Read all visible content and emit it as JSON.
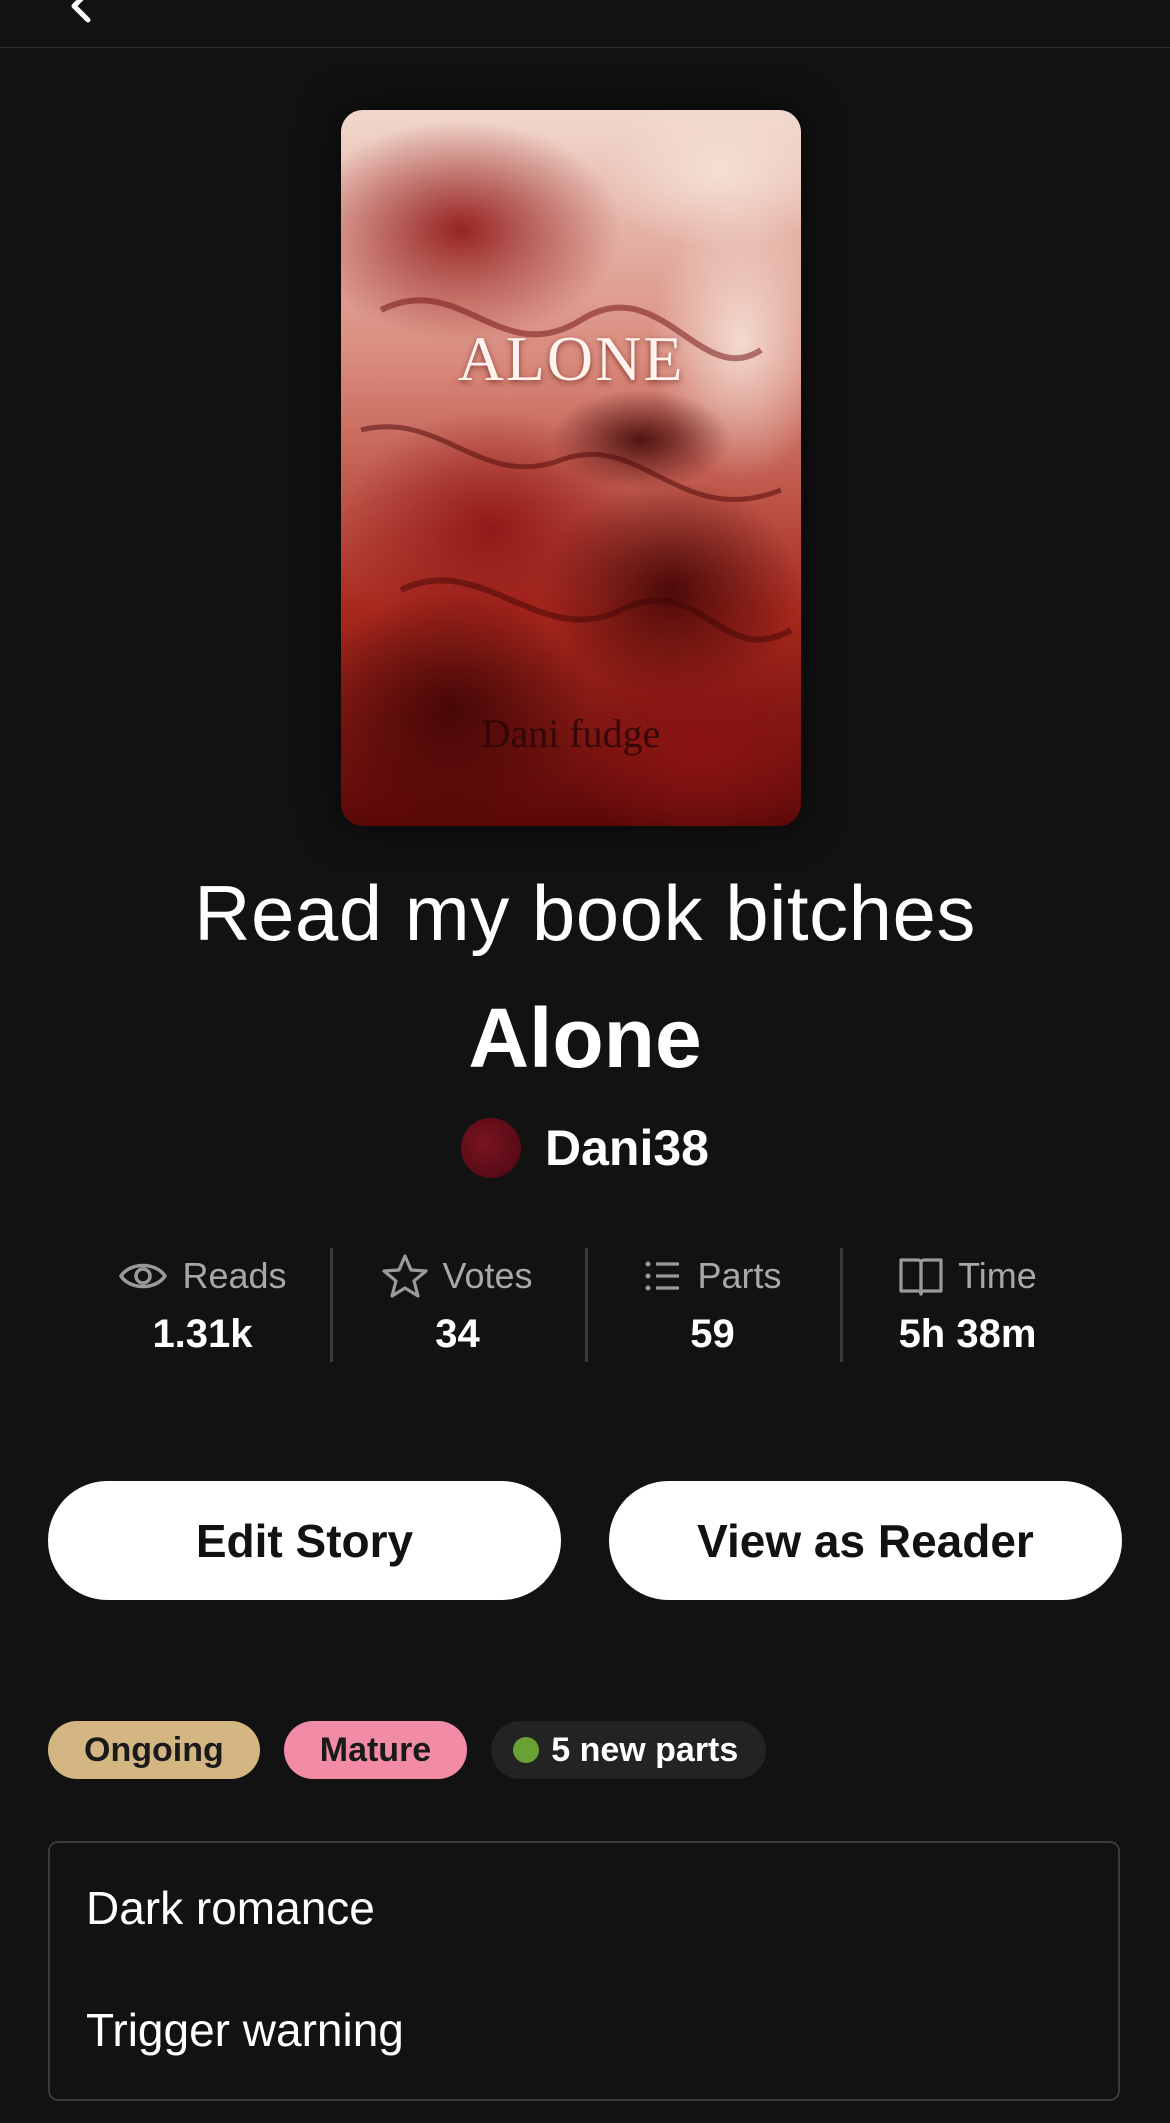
{
  "nav": {
    "back_icon": "chevron-left-icon"
  },
  "cover": {
    "title": "ALONE",
    "author": "Dani fudge",
    "colors": [
      "#f3ddd3",
      "#c0392b",
      "#7b1010",
      "#3a0505"
    ]
  },
  "reading_list_title": "Read my book bitches",
  "story": {
    "title": "Alone",
    "author": "Dani38"
  },
  "stats": [
    {
      "icon": "eye-icon",
      "label": "Reads",
      "value": "1.31k"
    },
    {
      "icon": "star-icon",
      "label": "Votes",
      "value": "34"
    },
    {
      "icon": "list-icon",
      "label": "Parts",
      "value": "59"
    },
    {
      "icon": "book-icon",
      "label": "Time",
      "value": "5h 38m"
    }
  ],
  "buttons": {
    "edit": "Edit Story",
    "view": "View as Reader"
  },
  "tags": {
    "status": "Ongoing",
    "rating": "Mature",
    "new_parts": "5 new parts"
  },
  "description": {
    "lines": [
      "Dark romance",
      "Trigger warning"
    ]
  },
  "colors": {
    "background": "#121212",
    "ongoing": "#d4b683",
    "mature": "#f28ba6",
    "new_dot": "#6aa135"
  }
}
